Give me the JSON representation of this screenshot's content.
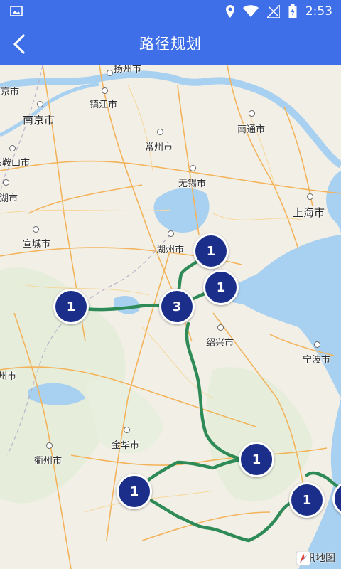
{
  "status_bar": {
    "time": "2:53"
  },
  "app_bar": {
    "title": "路径规划"
  },
  "map": {
    "cities": [
      {
        "name": "扬州市"
      },
      {
        "name": "镇江市"
      },
      {
        "name": "南京市"
      },
      {
        "name": "常州市"
      },
      {
        "name": "南通市"
      },
      {
        "name": "马鞍山市"
      },
      {
        "name": "无锡市"
      },
      {
        "name": "芜湖市"
      },
      {
        "name": "上海市"
      },
      {
        "name": "宣城市"
      },
      {
        "name": "湖州市"
      },
      {
        "name": "绍兴市"
      },
      {
        "name": "宁波市"
      },
      {
        "name": "金华市"
      },
      {
        "name": "衢州市"
      },
      {
        "name": "池州市"
      },
      {
        "name": "南京市"
      }
    ],
    "markers": [
      {
        "count": "1"
      },
      {
        "count": "1"
      },
      {
        "count": "3"
      },
      {
        "count": "1"
      },
      {
        "count": "1"
      },
      {
        "count": "1"
      },
      {
        "count": "1"
      }
    ],
    "route_color": "#2e8b57",
    "marker_color": "#1b2f8a",
    "attribution": "腾讯地图"
  }
}
